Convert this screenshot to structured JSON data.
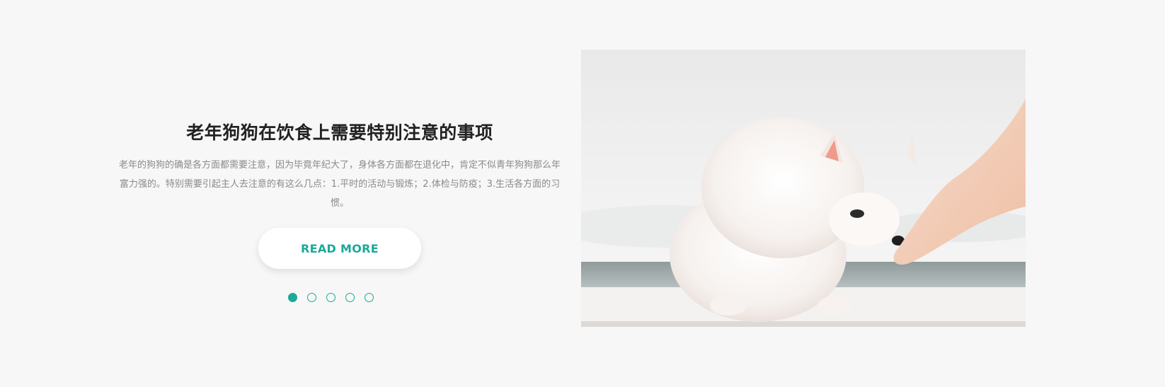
{
  "slide": {
    "title": "老年狗狗在饮食上需要特别注意的事项",
    "description": "老年的狗狗的确是各方面都需要注意，因为毕竟年纪大了，身体各方面都在退化中，肯定不似青年狗狗那么年富力强的。特别需要引起主人去注意的有这么几点：1.平时的活动与锻炼；2.体检与防疫；3.生活各方面的习惯。",
    "button_label": "READ MORE",
    "active_index": 0,
    "total_slides": 5
  },
  "colors": {
    "accent": "#1aaa98",
    "background": "#f7f7f7",
    "title": "#222222",
    "description": "#8a8a8a"
  }
}
